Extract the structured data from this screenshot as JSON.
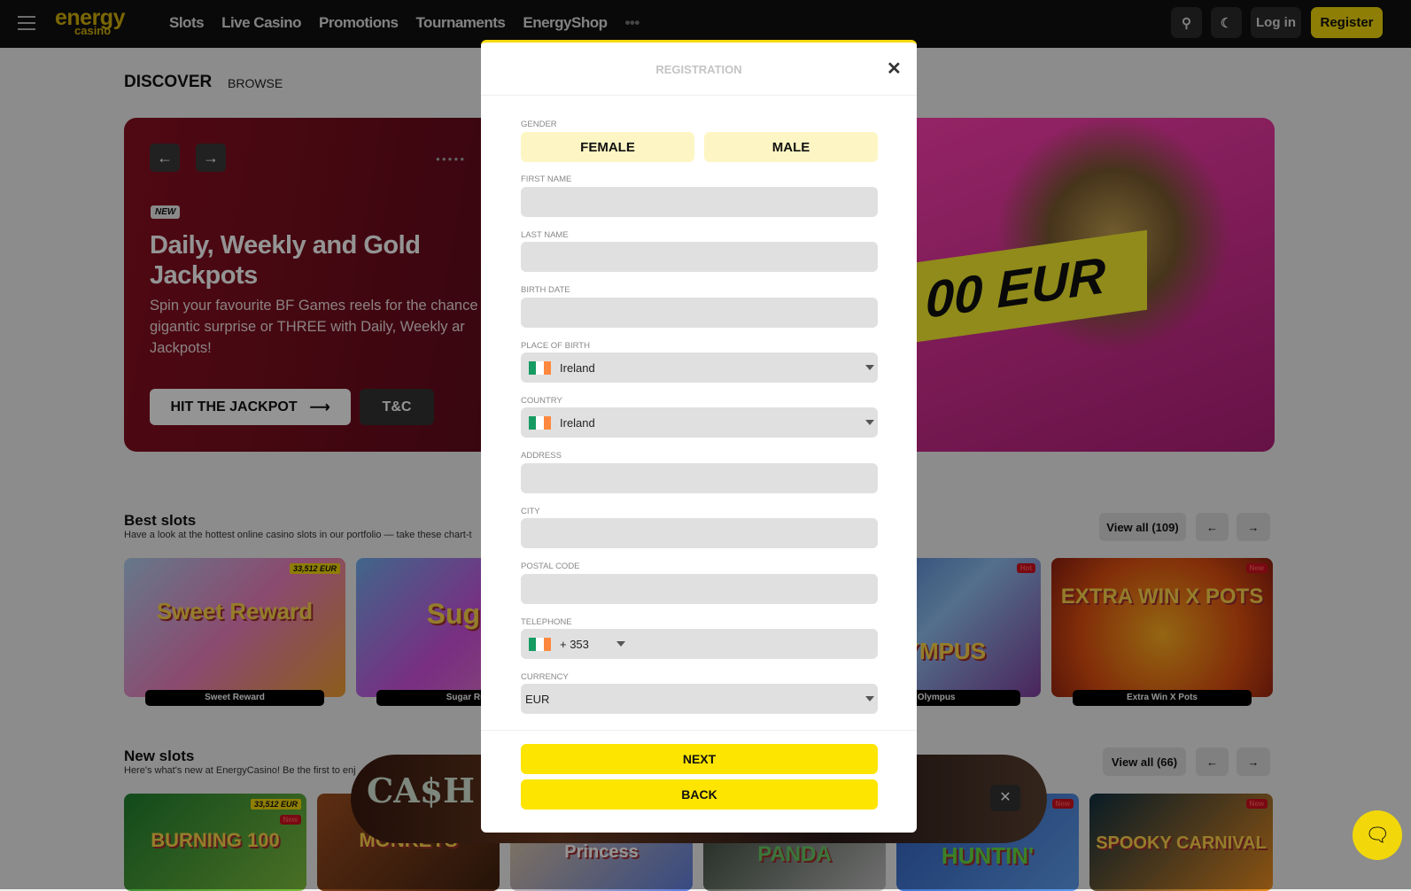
{
  "header": {
    "logo_main": "energy",
    "logo_sub": "casino",
    "nav": [
      "Slots",
      "Live Casino",
      "Promotions",
      "Tournaments",
      "EnergyShop"
    ],
    "more": "•••",
    "login": "Log in",
    "register": "Register",
    "brand_color": "#d4b20a"
  },
  "tabs": {
    "discover": "DISCOVER",
    "browse": "BROWSE"
  },
  "hero": {
    "badge": "NEW",
    "title": "Daily, Weekly and Gold Jackpots",
    "description": "Spin your favourite BF Games reels for the chance a gigantic surprise or THREE with Daily, Weekly ar Jackpots!",
    "cta": "HIT THE JACKPOT",
    "tc": "T&C",
    "image_text": "00 EUR"
  },
  "best_slots": {
    "title": "Best slots",
    "subtitle": "Have a look at the hottest online casino slots in our portfolio — take these chart-t",
    "view_all": "View all (109)",
    "games": [
      {
        "name": "Sweet Reward",
        "art": "Sweet Reward",
        "jackpot": "33,512 EUR"
      },
      {
        "name": "Sugar Ru",
        "art": "Sugar"
      },
      {
        "name": "of Olympus",
        "art": "OLYMPUS",
        "badge": "Hot"
      },
      {
        "name": "Extra Win X Pots",
        "art": "EXTRA WIN X POTS",
        "badge": "New"
      }
    ]
  },
  "new_slots": {
    "title": "New slots",
    "subtitle": "Here's what's new at EnergyCasino! Be the first to enj",
    "view_all": "View all (66)",
    "games": [
      {
        "art": "BURNING 100",
        "jackpot": "33,512 EUR",
        "badge": "New"
      },
      {
        "art": "MONKEYS"
      },
      {
        "art": "Princess"
      },
      {
        "art": "PANDA"
      },
      {
        "art": "HUNTIN'",
        "badge": "New"
      },
      {
        "art": "SPOOKY CARNIVAL",
        "badge": "New"
      }
    ]
  },
  "promo_popup": {
    "art": "CA$H MESH"
  },
  "modal": {
    "title": "REGISTRATION",
    "gender_label": "GENDER",
    "female": "FEMALE",
    "male": "MALE",
    "fields": {
      "first_name": "FIRST NAME",
      "last_name": "LAST NAME",
      "birth_date": "BIRTH DATE",
      "place_of_birth": "PLACE OF BIRTH",
      "country": "COUNTRY",
      "address": "ADDRESS",
      "city": "CITY",
      "postal_code": "POSTAL CODE",
      "telephone": "TELEPHONE",
      "currency": "CURRENCY"
    },
    "values": {
      "place_of_birth": "Ireland",
      "country": "Ireland",
      "phone_code": "+ 353",
      "currency": "EUR"
    },
    "next": "NEXT",
    "back": "BACK",
    "accent": "#fde500"
  }
}
